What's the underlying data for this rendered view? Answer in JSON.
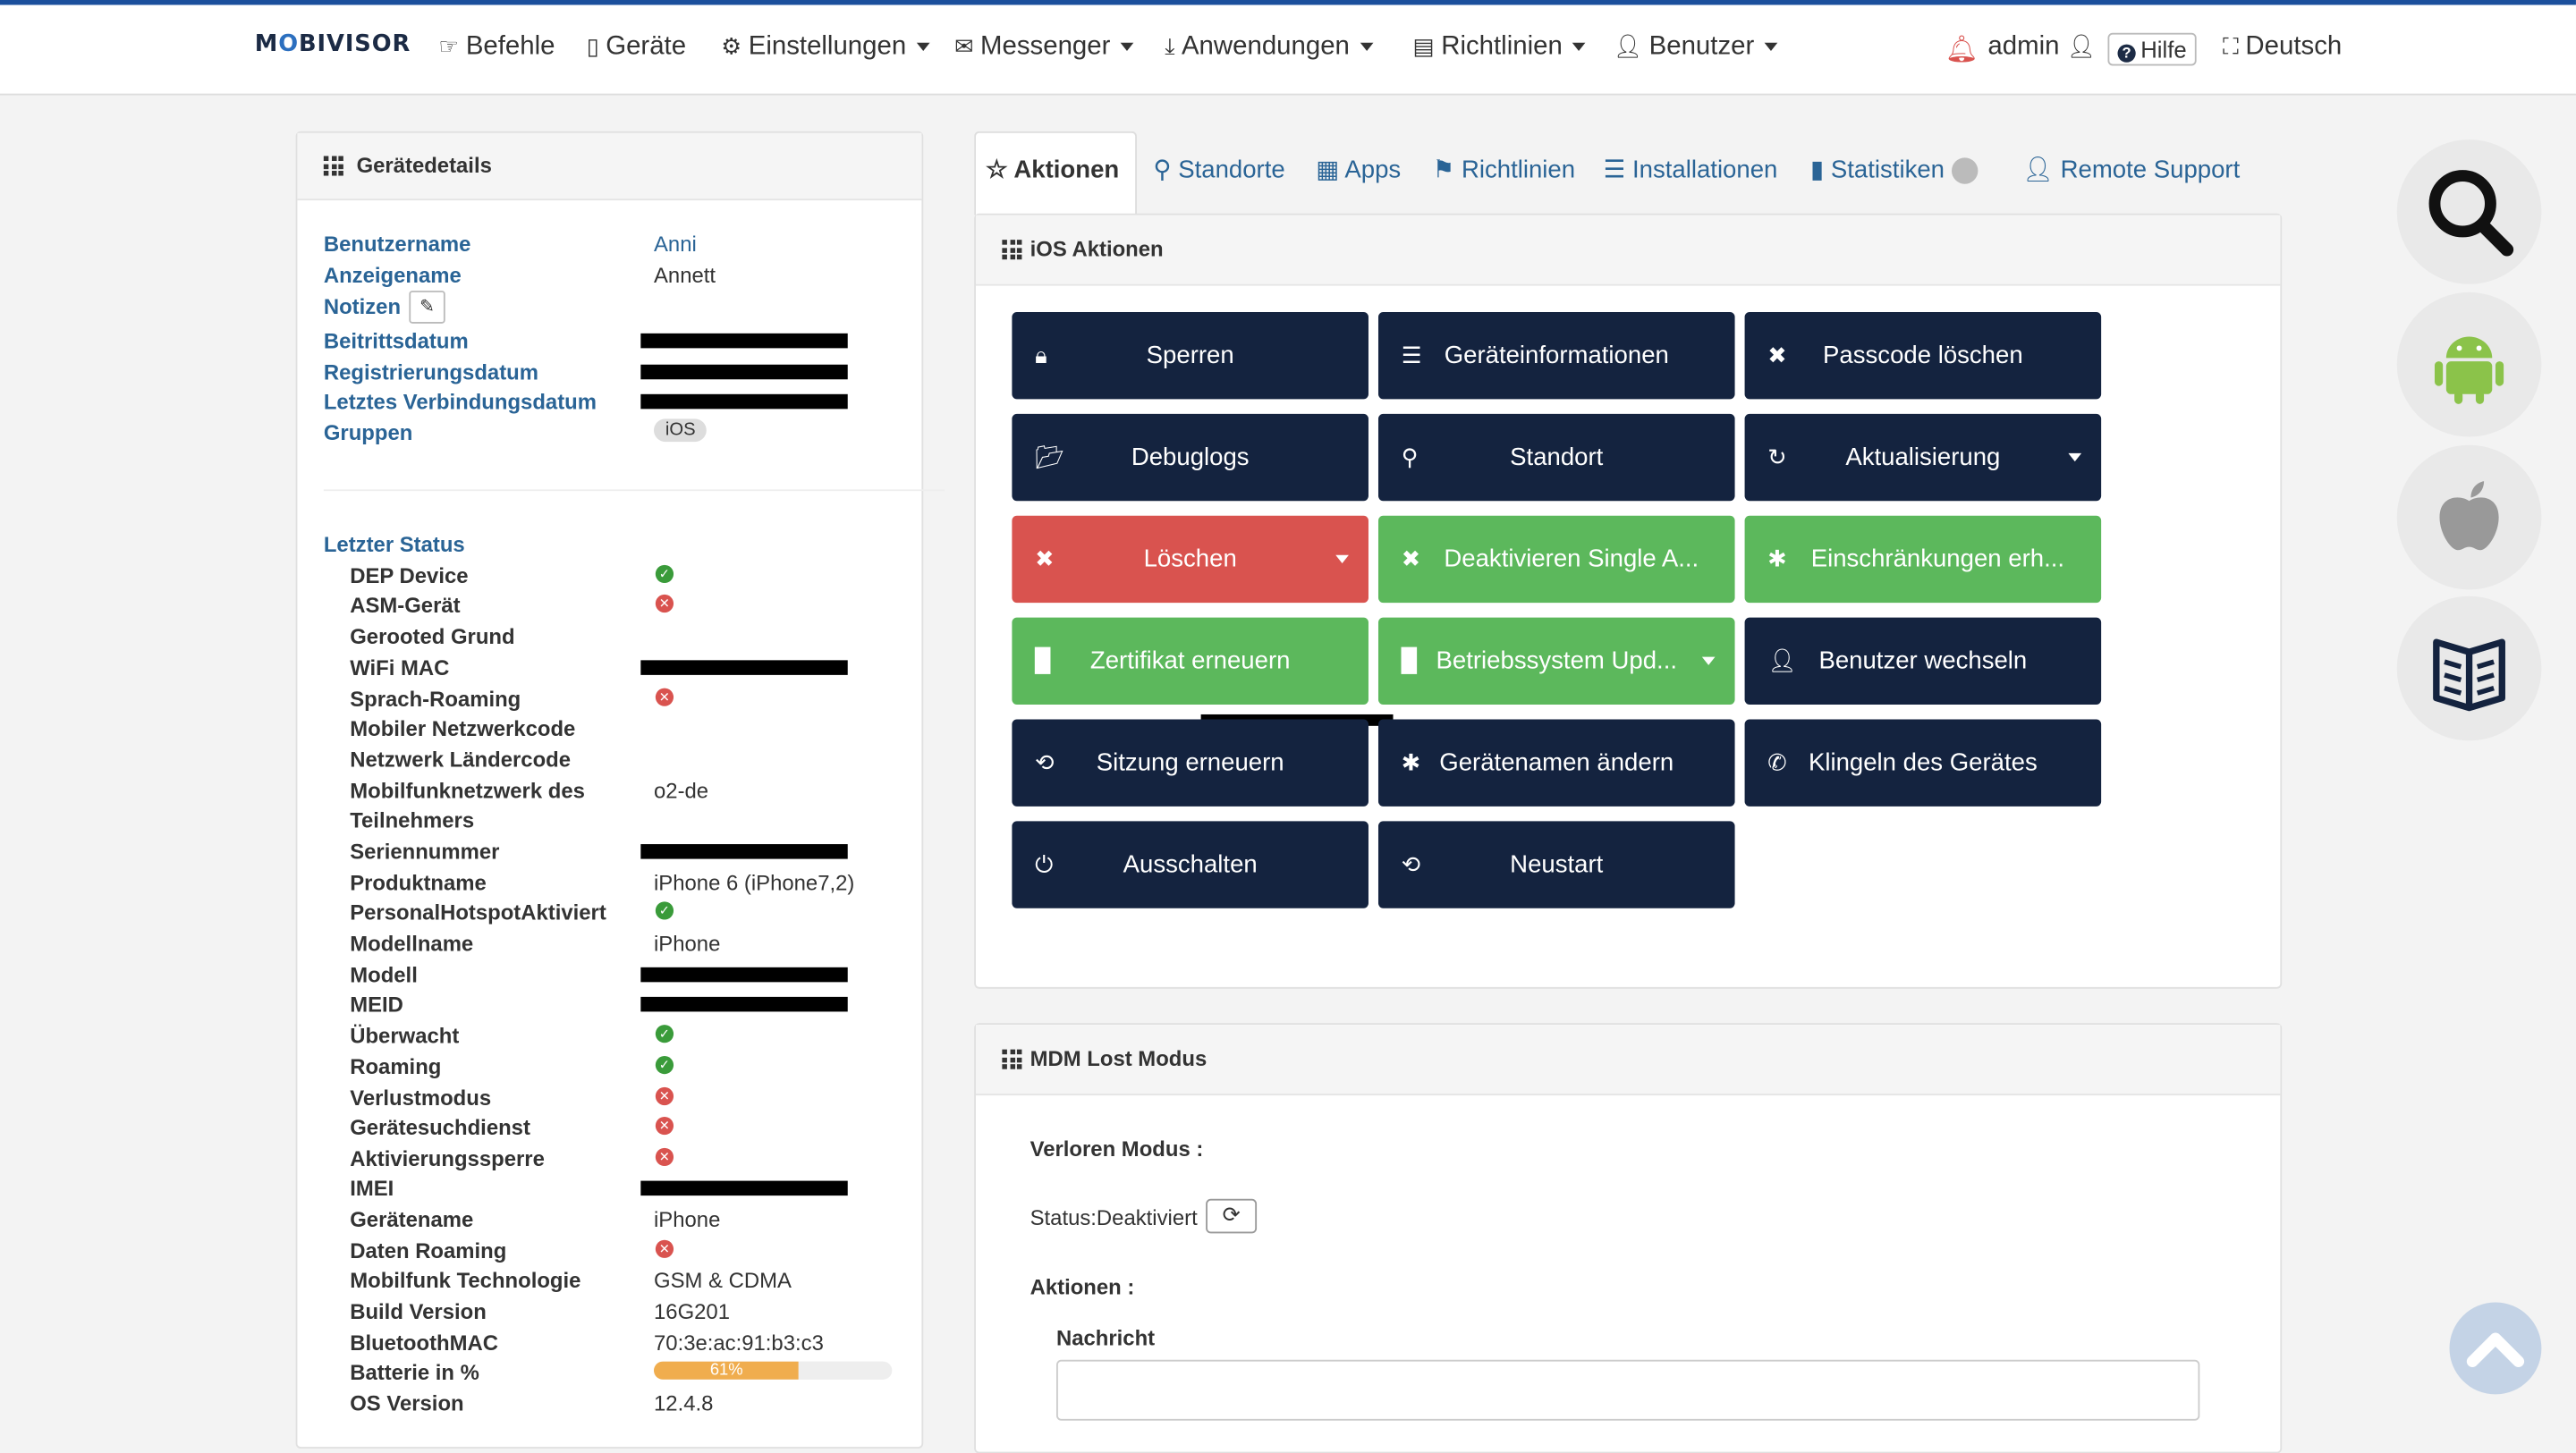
{
  "brand": {
    "text": "MOBIVISOR"
  },
  "nav": {
    "befehle": "Befehle",
    "geraete": "Geräte",
    "einstellungen": "Einstellungen",
    "messenger": "Messenger",
    "anwendungen": "Anwendungen",
    "richtlinien": "Richtlinien",
    "benutzer": "Benutzer",
    "admin": "admin",
    "hilfe": "Hilfe",
    "sprache": "Deutsch"
  },
  "details": {
    "title": "Gerätedetails",
    "benutzername_label": "Benutzername",
    "benutzername": "Anni",
    "anzeigename_label": "Anzeigename",
    "anzeigename": "Annett",
    "notizen_label": "Notizen",
    "beitritt_label": "Beitrittsdatum",
    "registrierung_label": "Registrierungsdatum",
    "verbindung_label": "Letztes Verbindungsdatum",
    "gruppen_label": "Gruppen",
    "gruppe": "iOS"
  },
  "status": {
    "title": "Letzter Status",
    "dep": "DEP Device",
    "asm": "ASM-Gerät",
    "gerooted": "Gerooted Grund",
    "wifi": "WiFi MAC",
    "sprach": "Sprach-Roaming",
    "mnc": "Mobiler Netzwerkcode",
    "mcc": "Netzwerk Ländercode",
    "carrier1": "Mobilfunknetzwerk des",
    "carrier2": "Teilnehmers",
    "carrier_val": "o2-de",
    "serien": "Seriennummer",
    "produkt": "Produktname",
    "produkt_val": "iPhone 6 (iPhone7,2)",
    "hotspot": "PersonalHotspotAktiviert",
    "modellname": "Modellname",
    "modellname_val": "iPhone",
    "modell": "Modell",
    "meid": "MEID",
    "ueberwacht": "Überwacht",
    "roaming": "Roaming",
    "verlust": "Verlustmodus",
    "suchdienst": "Gerätesuchdienst",
    "aktivierung": "Aktivierungssperre",
    "imei": "IMEI",
    "geraetename": "Gerätename",
    "geraetename_val": "iPhone",
    "daten": "Daten Roaming",
    "technologie": "Mobilfunk Technologie",
    "technologie_val": "GSM & CDMA",
    "build": "Build Version",
    "build_val": "16G201",
    "bt": "BluetoothMAC",
    "bt_val": "70:3e:ac:91:b3:c3",
    "batterie": "Batterie in %",
    "batterie_val": "61%",
    "batterie_level": 61,
    "os": "OS Version",
    "os_val": "12.4.8"
  },
  "tabs": {
    "aktionen": "Aktionen",
    "standorte": "Standorte",
    "apps": "Apps",
    "richtlinien": "Richtlinien",
    "installationen": "Installationen",
    "statistiken": "Statistiken",
    "remote": "Remote Support"
  },
  "ios": {
    "title": "iOS Aktionen",
    "sperren": "Sperren",
    "info": "Geräteinformationen",
    "passcode": "Passcode löschen",
    "debug": "Debuglogs",
    "standort": "Standort",
    "aktualisierung": "Aktualisierung",
    "loeschen": "Löschen",
    "single": "Deaktivieren Single A...",
    "einschr": "Einschränkungen erh...",
    "zertifikat": "Zertifikat erneuern",
    "os_update": "Betriebssystem Upd...",
    "benutzer": "Benutzer wechseln",
    "sitzung": "Sitzung erneuern",
    "namen": "Gerätenamen ändern",
    "klingeln": "Klingeln des Gerätes",
    "aus": "Ausschalten",
    "neustart": "Neustart"
  },
  "lost": {
    "title": "MDM Lost Modus",
    "modus": "Verloren Modus :",
    "status": "Status:Deaktiviert",
    "aktionen": "Aktionen :",
    "nachricht": "Nachricht"
  },
  "colors": {
    "navy": "#14233f",
    "red": "#d9534f",
    "green": "#5cb85c",
    "link": "#2a6496"
  }
}
